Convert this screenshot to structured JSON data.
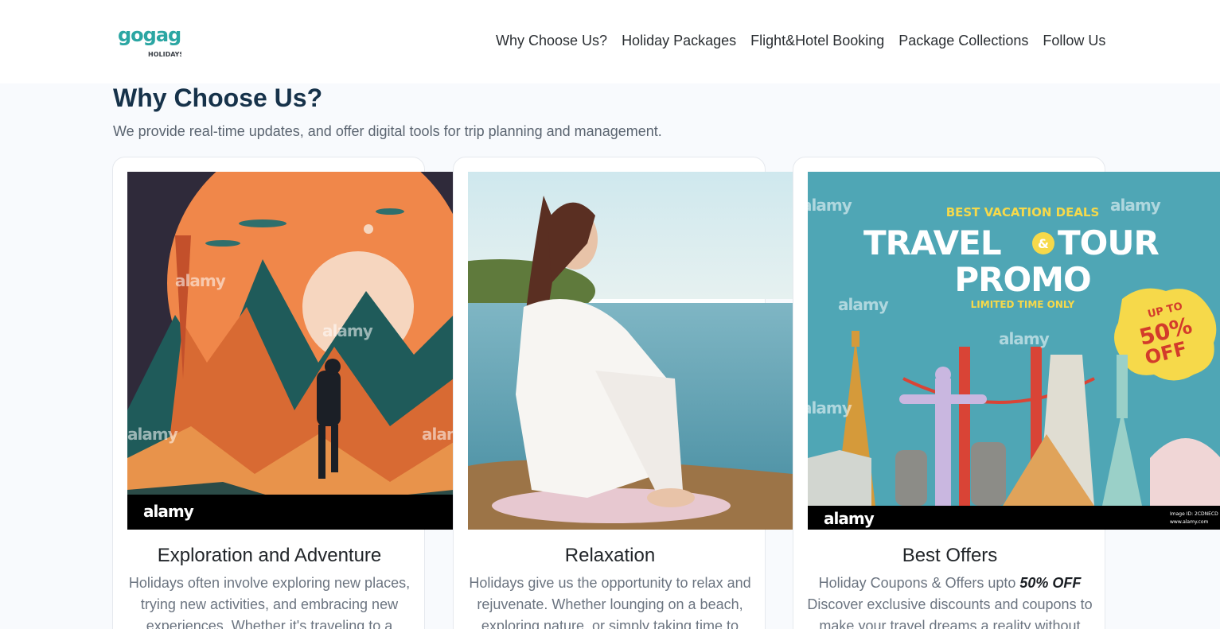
{
  "brand": {
    "logo_main": "gogaga",
    "logo_sub": "HOLIDAYS"
  },
  "nav": {
    "items": [
      {
        "label": "Why Choose Us?"
      },
      {
        "label": "Holiday Packages"
      },
      {
        "label": "Flight&Hotel Booking"
      },
      {
        "label": "Package Collections"
      },
      {
        "label": "Follow Us"
      }
    ]
  },
  "section": {
    "title": "Why Choose Us?",
    "subtitle": "We provide real-time updates, and offer digital tools for trip planning and management."
  },
  "cards": [
    {
      "title": "Exploration and Adventure",
      "text": "Holidays often involve exploring new places, trying new activities, and embracing new experiences. Whether it's traveling to a",
      "image_watermark": "alamy"
    },
    {
      "title": "Relaxation",
      "text": "Holidays give us the opportunity to relax and rejuvenate. Whether lounging on a beach, exploring nature, or simply taking time to"
    },
    {
      "title": "Best Offers",
      "text_prefix": "Holiday Coupons & Offers upto ",
      "text_emphasis": "50% OFF",
      "text_rest": "Discover exclusive discounts and coupons to make your travel dreams a reality without",
      "image_watermark": "alamy",
      "promo": {
        "kicker": "BEST VACATION DEALS",
        "line1": "TRAVEL",
        "amp": "&",
        "line2": "TOUR",
        "line3": "PROMO",
        "limited": "LIMITED TIME ONLY",
        "badge_top": "UP TO",
        "badge_mid": "50%",
        "badge_bottom": "OFF",
        "image_id": "Image ID: 2CDNECD",
        "site": "www.alamy.com"
      }
    }
  ],
  "colors": {
    "heading": "#16324a",
    "nav_text": "#2b2f33",
    "page_bg": "#f8fafd",
    "promo_teal": "#4fa6b5",
    "promo_yellow": "#f6d94a"
  }
}
